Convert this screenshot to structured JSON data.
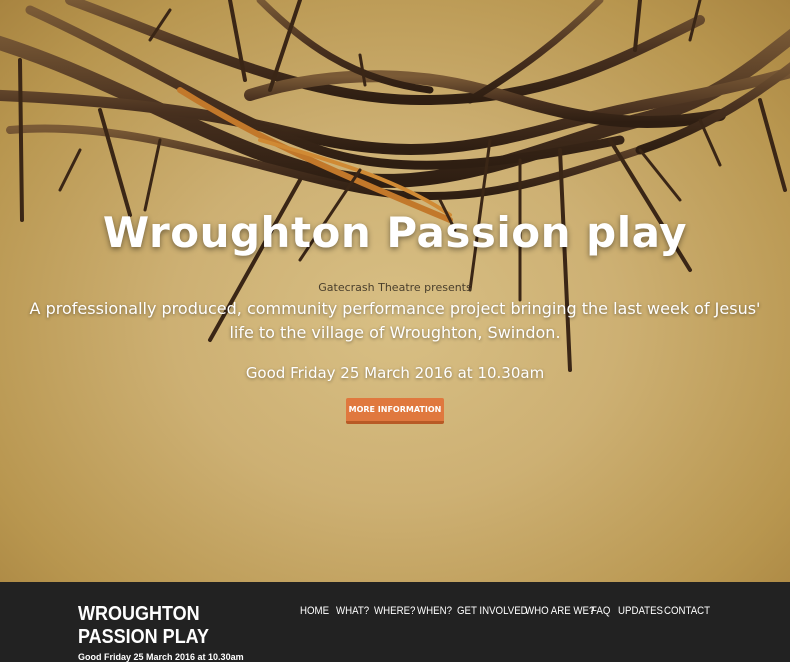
{
  "hero": {
    "title": "Wroughton Passion play",
    "presents": "Gatecrash Theatre presents",
    "description": "A professionally produced, community performance project bringing the last week of Jesus' life to the village of Wroughton, Swindon.",
    "date": "Good Friday 25 March 2016 at 10.30am",
    "button_label": "MORE INFORMATION",
    "image": "crown-of-thorns"
  },
  "navbar": {
    "brand": "WROUGHTON PASSION PLAY",
    "brand_date": "Good Friday 25 March 2016 at 10.30am",
    "items": [
      {
        "label": "HOME"
      },
      {
        "label": "WHAT?"
      },
      {
        "label": "WHERE?"
      },
      {
        "label": "WHEN?"
      },
      {
        "label": "GET INVOLVED"
      },
      {
        "label": "WHO ARE WE?"
      },
      {
        "label": "FAQ"
      },
      {
        "label": "UPDATES"
      },
      {
        "label": "CONTACT"
      }
    ]
  },
  "colors": {
    "accent": "#e0783e",
    "navbar_bg": "#222222",
    "hero_bg": "#cdb073"
  }
}
